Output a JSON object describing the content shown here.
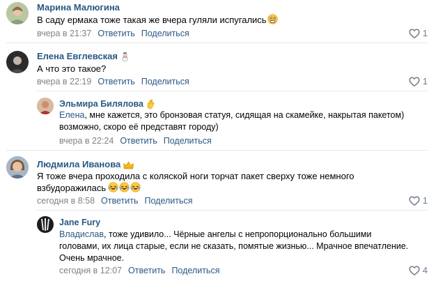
{
  "comments": [
    {
      "author": "Марина Малюгина",
      "text": "В саду ермака тоже такая же вчера гуляли испугались",
      "date": "вчера в 21:37",
      "reply": "Ответить",
      "share": "Поделиться",
      "likes": "1",
      "emoji": "astonished-face"
    },
    {
      "author": "Елена Евглевская",
      "text": "А что это такое?",
      "date": "вчера в 22:19",
      "reply": "Ответить",
      "share": "Поделиться",
      "likes": "1",
      "badge": "snowman"
    },
    {
      "author": "Эльмира Билялова",
      "mention": "Елена",
      "text_line1": ", мне кажется, это бронзовая статуя, сидящая на скамейке, накрытая пакетом)",
      "text_line2": "возможно, скоро её представят городу)",
      "date": "вчера в 22:24",
      "reply": "Ответить",
      "share": "Поделиться",
      "likes": "1",
      "badge": "ok-hand"
    },
    {
      "author": "Людмила Иванова",
      "text_line1": "Я тоже вчера проходила с коляской ноги торчат пакет сверху тоже немного",
      "text_line2": "взбудоражилась",
      "date": "сегодня в 8:58",
      "reply": "Ответить",
      "share": "Поделиться",
      "likes": "1",
      "badge": "crown",
      "emoji": "rolling-laughing-face"
    },
    {
      "author": "Jane Fury",
      "mention": "Владислав",
      "text_line1": ", тоже удивило... Чёрные ангелы с непропорционально большими",
      "text_line2": "головами, их лица старые, если не сказать, помятые жизнью... Мрачное впечатление.",
      "text_line3": "Очень мрачное.",
      "date": "сегодня в 12:07",
      "reply": "Ответить",
      "share": "Поделиться",
      "likes": "4"
    }
  ],
  "colors": {
    "link": "#2a5885",
    "meta": "#828282",
    "like": "#6f7c8b",
    "separator": "#e7e8ec"
  }
}
